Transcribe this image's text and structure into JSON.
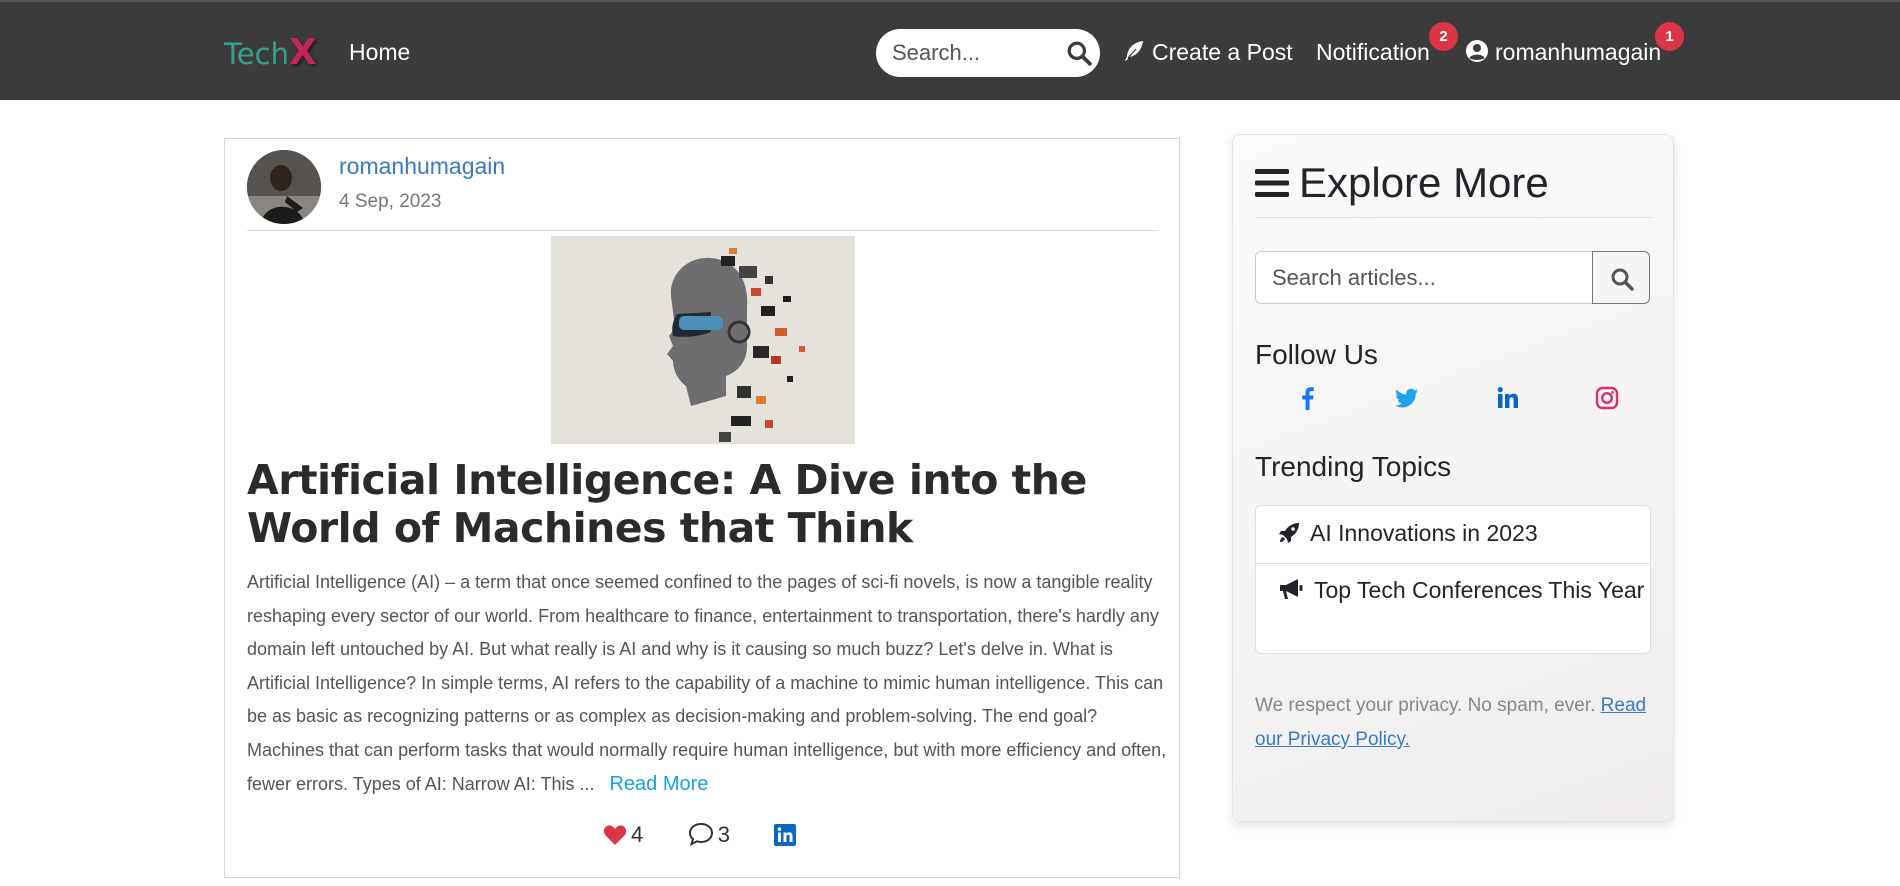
{
  "nav": {
    "brand_part1": "Tech",
    "brand_part2": "X",
    "home": "Home",
    "search_placeholder": "Search...",
    "create_post": "Create a Post",
    "notification": "Notification",
    "notification_count": "2",
    "username": "romanhumagain",
    "user_count": "1"
  },
  "post": {
    "author": "romanhumagain",
    "date": "4 Sep, 2023",
    "title": "Artificial Intelligence: A Dive into the World of Machines that Think",
    "excerpt": "Artificial Intelligence (AI) – a term that once seemed confined to the pages of sci-fi novels, is now a tangible reality reshaping every sector of our world. From healthcare to finance, entertainment to transportation, there's hardly any domain left untouched by AI. But what really is AI and why is it causing so much buzz? Let's delve in. What is Artificial Intelligence? In simple terms, AI refers to the capability of a machine to mimic human intelligence. This can be as basic as recognizing patterns or as complex as decision-making and problem-solving. The end goal? Machines that can perform tasks that would normally require human intelligence, but with more efficiency and often, fewer errors. Types of AI: Narrow AI: This ...",
    "read_more": "Read More",
    "likes": "4",
    "comments": "3"
  },
  "sidebar": {
    "title": "Explore More",
    "search_placeholder": "Search articles...",
    "follow_title": "Follow Us",
    "trending_title": "Trending Topics",
    "trending": [
      {
        "label": "AI Innovations in 2023",
        "icon": "rocket-icon"
      },
      {
        "label": "Top Tech Conferences This Year",
        "icon": "megaphone-icon"
      }
    ],
    "privacy_text": "We respect your privacy. No spam, ever.",
    "privacy_link": "Read our Privacy Policy."
  },
  "colors": {
    "navbar_bg": "#3c3c3c",
    "brand_teal": "#3a9e8f",
    "brand_pink": "#c0265c",
    "badge_red": "#dc3545",
    "link_blue": "#3a7bbf",
    "read_more": "#17a2d8",
    "like_red": "#dc3545",
    "facebook": "#1877f2",
    "twitter": "#1da1f2",
    "linkedin": "#0a66c2",
    "instagram": "#d6336c"
  }
}
